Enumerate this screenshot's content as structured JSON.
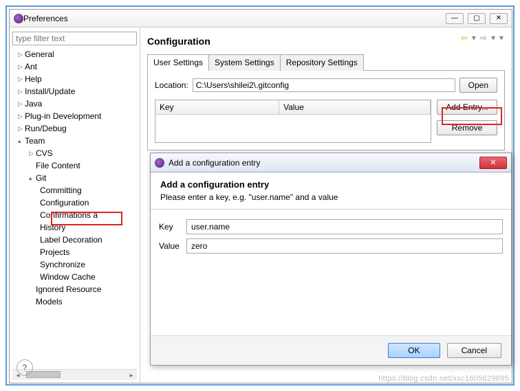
{
  "prefs": {
    "title": "Preferences",
    "filter_placeholder": "type filter text",
    "tree": {
      "general": "General",
      "ant": "Ant",
      "help": "Help",
      "install": "Install/Update",
      "java": "Java",
      "plugin": "Plug-in Development",
      "run": "Run/Debug",
      "team": "Team",
      "cvs": "CVS",
      "filecontent": "File Content",
      "git": "Git",
      "committing": "Committing",
      "configuration": "Configuration",
      "confirmations": "Confirmations a",
      "history": "History",
      "labeldec": "Label Decoration",
      "projects": "Projects",
      "synchronize": "Synchronize",
      "windowcache": "Window Cache",
      "ignored": "Ignored Resource",
      "models": "Models"
    }
  },
  "config": {
    "heading": "Configuration",
    "tabs": {
      "user": "User Settings",
      "system": "System Settings",
      "repo": "Repository Settings"
    },
    "location_label": "Location:",
    "location_value": "C:\\Users\\shilei2\\.gitconfig",
    "open": "Open",
    "table": {
      "key": "Key",
      "value": "Value"
    },
    "add_entry": "Add Entry...",
    "remove": "Remove"
  },
  "dialog": {
    "title": "Add a configuration entry",
    "heading": "Add a configuration entry",
    "desc": "Please enter a key, e.g. \"user.name\" and a value",
    "key_label": "Key",
    "value_label": "Value",
    "key_value": "user.name",
    "value_value": "zero",
    "ok": "OK",
    "cancel": "Cancel"
  },
  "watermark": "https://blog.csdn.net/xxc1605629895"
}
